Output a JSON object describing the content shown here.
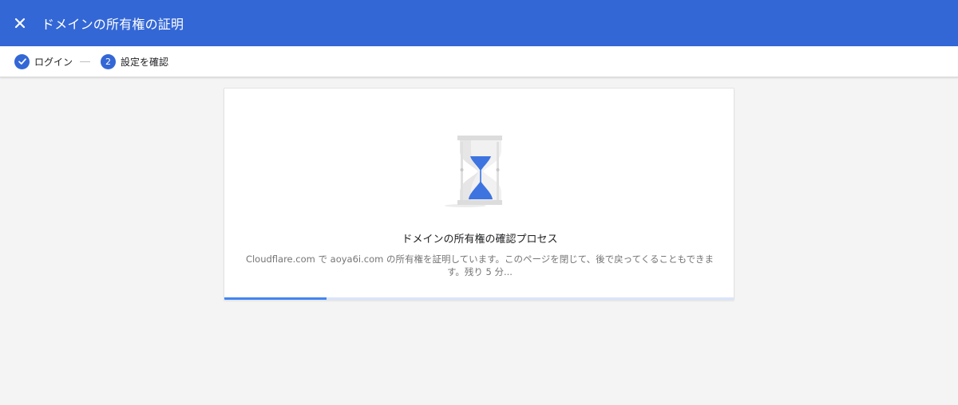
{
  "appbar": {
    "title": "ドメインの所有権の証明",
    "close_icon": "close-icon",
    "background": "#3367d6"
  },
  "stepper": {
    "steps": [
      {
        "label": "ログイン",
        "state": "completed",
        "icon": "check-icon"
      },
      {
        "label": "設定を確認",
        "state": "active",
        "number": "2"
      }
    ],
    "accent": "#3367d6"
  },
  "card": {
    "illustration": "hourglass-icon",
    "title": "ドメインの所有権の確認プロセス",
    "description": "Cloudflare.com で aoya6i.com の所有権を証明しています。このページを閉じて、後で戻ってくることもできます。残り 5 分...",
    "progress_fraction": 0.2,
    "progress_color": "#4285f4"
  }
}
